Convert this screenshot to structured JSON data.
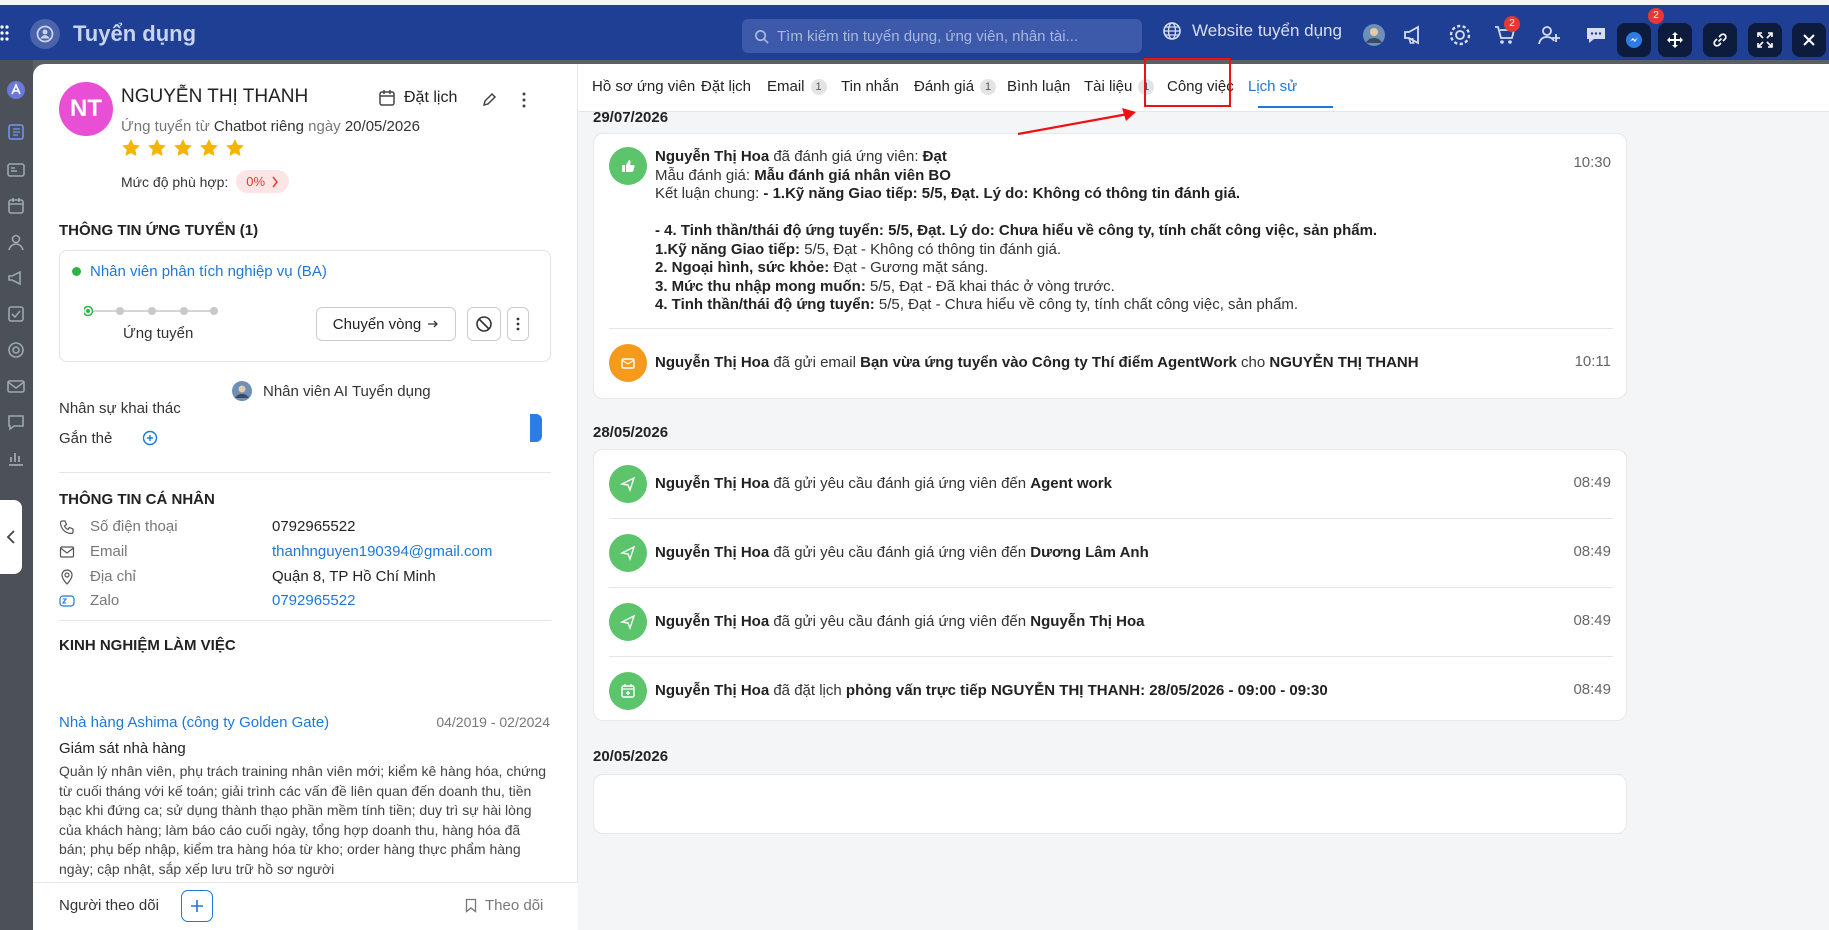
{
  "topbar": {
    "title": "Tuyển dụng",
    "search_placeholder": "Tìm kiếm tin tuyển dụng, ứng viên, nhân tài...",
    "website_label": "Website tuyển dụng",
    "notif_count": "2",
    "cart_count": "2"
  },
  "candidate": {
    "initials": "NT",
    "name": "NGUYỄN THỊ THANH",
    "schedule_label": "Đặt lịch",
    "applied_prefix": "Ứng tuyển từ",
    "applied_source": "Chatbot riêng",
    "applied_mid": "ngày",
    "applied_date": "20/05/2026",
    "rating": 5,
    "fit_label": "Mức độ phù hợp:",
    "fit_value": "0%"
  },
  "application": {
    "section_title": "THÔNG TIN ỨNG TUYỂN (1)",
    "job_title": "Nhân viên phân tích nghiệp vụ (BA)",
    "stage": "Ứng tuyển",
    "move_label": "Chuyển vòng",
    "recruiter_label": "Nhân sự khai thác",
    "recruiter_name": "Nhân viên AI Tuyển dụng",
    "tags_label": "Gắn thẻ"
  },
  "personal": {
    "section_title": "THÔNG TIN CÁ NHÂN",
    "rows": [
      {
        "key": "Số điện thoại",
        "value": "0792965522",
        "icon": "phone-icon"
      },
      {
        "key": "Email",
        "value": "thanhnguyen190394@gmail.com",
        "icon": "mail-icon"
      },
      {
        "key": "Địa chỉ",
        "value": "Quận 8, TP Hồ Chí Minh",
        "icon": "location-icon"
      },
      {
        "key": "Zalo",
        "value": "0792965522",
        "icon": "zalo-icon"
      }
    ]
  },
  "experience": {
    "section_title": "KINH NGHIỆM LÀM VIỆC",
    "company": "Nhà hàng Ashima (công ty Golden Gate)",
    "dates": "04/2019 - 02/2024",
    "role": "Giám sát nhà hàng",
    "description": "Quản lý nhân viên, phụ trách training nhân viên mới; kiểm kê hàng hóa, chứng từ cuối tháng với kế toán; giải trình các vấn đề liên quan đến doanh thu, tiền bạc khi đứng ca; sử dụng thành thạo phần mềm tính tiền; duy trì sự hài lòng của khách hàng; làm báo cáo cuối ngày, tổng hợp doanh thu, hàng hóa đã bán; phụ bếp nhập, kiểm tra hàng hóa từ kho; order hàng thực phẩm hàng ngày; cập nhật, sắp xếp lưu trữ hồ sơ người"
  },
  "footer": {
    "followers_label": "Người theo dõi",
    "track_label": "Theo dõi"
  },
  "tabs": [
    {
      "label": "Hồ sơ ứng viên",
      "count": ""
    },
    {
      "label": "Đặt lịch",
      "count": ""
    },
    {
      "label": "Email",
      "count": "1"
    },
    {
      "label": "Tin nhắn",
      "count": ""
    },
    {
      "label": "Đánh giá",
      "count": "1"
    },
    {
      "label": "Bình luận",
      "count": ""
    },
    {
      "label": "Tài liệu",
      "count": "1"
    },
    {
      "label": "Công việc",
      "count": ""
    },
    {
      "label": "Lịch sử",
      "count": ""
    }
  ],
  "active_tab": "Lịch sử",
  "history": {
    "groups": [
      {
        "date": "29/07/2026",
        "eval": {
          "actor": "Nguyễn Thị Hoa",
          "action": "đã đánh giá ứng viên:",
          "result": "Đạt",
          "template_label": "Mẫu đánh giá:",
          "template": "Mẫu đánh giá nhân viên BO",
          "conclusion_label": "Kết luận chung:",
          "conclusion_1": "- 1.Kỹ năng Giao tiếp: 5/5, Đạt. Lý do: Không có thông tin đánh giá.",
          "conclusion_2": "- 4. Tinh thần/thái độ ứng tuyển: 5/5, Đạt. Lý do: Chưa hiểu về công ty, tính chất công việc, sản phẩm.",
          "criteria": [
            {
              "name": "1.Kỹ năng Giao tiếp:",
              "detail": "5/5, Đạt - Không có thông tin đánh giá."
            },
            {
              "name": "2. Ngoại hình, sức khỏe:",
              "detail": "Đạt - Gương mặt sáng."
            },
            {
              "name": "3. Mức thu nhập mong muốn:",
              "detail": "5/5, Đạt - Đã khai thác ở vòng trước."
            },
            {
              "name": "4. Tinh thần/thái độ ứng tuyển:",
              "detail": "5/5, Đạt - Chưa hiểu về công ty, tính chất công việc, sản phẩm."
            }
          ],
          "time": "10:30"
        },
        "email": {
          "actor": "Nguyễn Thị Hoa",
          "action": "đã gửi email",
          "subject": "Bạn vừa ứng tuyển vào Công ty Thí điểm AgentWork",
          "to_word": "cho",
          "to": "NGUYỄN THỊ THANH",
          "time": "10:11"
        }
      },
      {
        "date": "28/05/2026",
        "items": [
          {
            "actor": "Nguyễn Thị Hoa",
            "action": "đã gửi yêu cầu đánh giá ứng viên đến",
            "target": "Agent work",
            "time": "08:49"
          },
          {
            "actor": "Nguyễn Thị Hoa",
            "action": "đã gửi yêu cầu đánh giá ứng viên đến",
            "target": "Dương Lâm Anh",
            "time": "08:49"
          },
          {
            "actor": "Nguyễn Thị Hoa",
            "action": "đã gửi yêu cầu đánh giá ứng viên đến",
            "target": "Nguyễn Thị Hoa",
            "time": "08:49"
          },
          {
            "actor": "Nguyễn Thị Hoa",
            "action": "đã đặt lịch",
            "target": "phỏng vấn trực tiếp NGUYỄN THỊ THANH: 28/05/2026 - 09:00 - 09:30",
            "time": "08:49"
          }
        ]
      },
      {
        "date": "20/05/2026"
      }
    ]
  },
  "colors": {
    "topbar": "#1f3f94",
    "accent": "#1e78d6",
    "green": "#5cc46b",
    "orange": "#f59a1b",
    "star": "#f5b400",
    "highlight": "#e11"
  }
}
